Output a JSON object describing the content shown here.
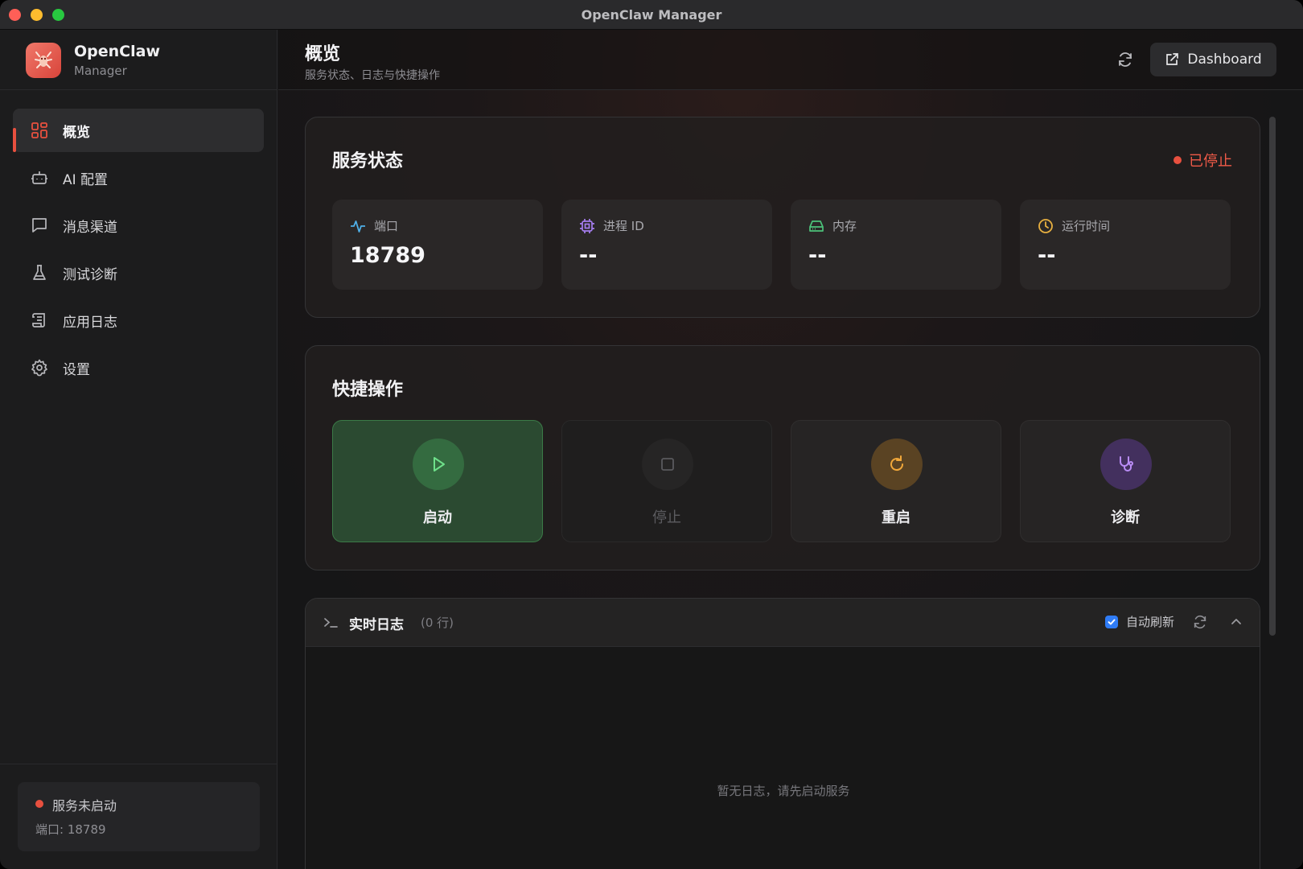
{
  "window": {
    "title": "OpenClaw Manager"
  },
  "sidebar": {
    "brand": {
      "name": "OpenClaw",
      "subtitle": "Manager"
    },
    "items": [
      {
        "label": "概览",
        "icon": "grid-icon",
        "active": true
      },
      {
        "label": "AI 配置",
        "icon": "robot-icon",
        "active": false
      },
      {
        "label": "消息渠道",
        "icon": "message-icon",
        "active": false
      },
      {
        "label": "测试诊断",
        "icon": "flask-icon",
        "active": false
      },
      {
        "label": "应用日志",
        "icon": "scroll-icon",
        "active": false
      },
      {
        "label": "设置",
        "icon": "gear-icon",
        "active": false
      }
    ],
    "footer": {
      "status": "服务未启动",
      "port": "端口: 18789"
    }
  },
  "header": {
    "title": "概览",
    "subtitle": "服务状态、日志与快捷操作",
    "dashboard_label": "Dashboard"
  },
  "service": {
    "title": "服务状态",
    "state": "已停止",
    "stats": [
      {
        "label": "端口",
        "value": "18789",
        "icon": "activity-icon"
      },
      {
        "label": "进程 ID",
        "value": "--",
        "icon": "cpu-icon"
      },
      {
        "label": "内存",
        "value": "--",
        "icon": "drive-icon"
      },
      {
        "label": "运行时间",
        "value": "--",
        "icon": "clock-icon"
      }
    ]
  },
  "actions": {
    "title": "快捷操作",
    "items": [
      {
        "label": "启动",
        "icon": "play-icon",
        "enabled": true
      },
      {
        "label": "停止",
        "icon": "stop-icon",
        "enabled": false
      },
      {
        "label": "重启",
        "icon": "restart-icon",
        "enabled": true
      },
      {
        "label": "诊断",
        "icon": "stethoscope-icon",
        "enabled": true
      }
    ]
  },
  "logs": {
    "title": "实时日志",
    "count": "(0 行)",
    "auto_refresh_label": "自动刷新",
    "auto_refresh_checked": true,
    "empty": "暂无日志，请先启动服务"
  },
  "colors": {
    "accent_red": "#e8503f",
    "start_green": "#3b7a47",
    "checkbox_blue": "#2f7cf6",
    "restart_orange": "#e0962e",
    "diag_purple": "#a67ef0"
  }
}
